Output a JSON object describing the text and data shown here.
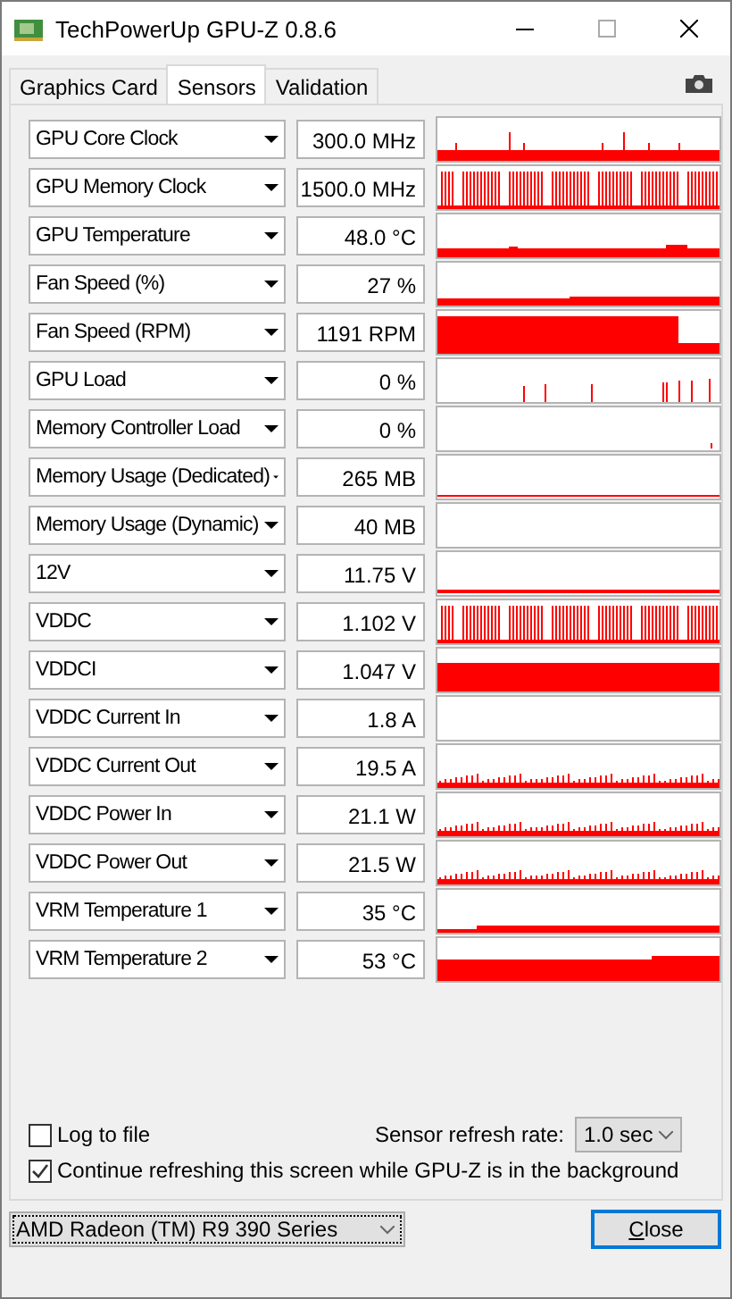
{
  "window": {
    "title": "TechPowerUp GPU-Z 0.8.6"
  },
  "tabs": [
    {
      "label": "Graphics Card",
      "selected": false
    },
    {
      "label": "Sensors",
      "selected": true
    },
    {
      "label": "Validation",
      "selected": false
    }
  ],
  "sensors": [
    {
      "name": "GPU Core Clock",
      "value": "300.0 MHz",
      "kind": "spikes"
    },
    {
      "name": "GPU Memory Clock",
      "value": "1500.0 MHz",
      "kind": "dense"
    },
    {
      "name": "GPU Temperature",
      "value": "48.0 °C",
      "kind": "low"
    },
    {
      "name": "Fan Speed (%)",
      "value": "27 %",
      "kind": "rise"
    },
    {
      "name": "Fan Speed (RPM)",
      "value": "1191 RPM",
      "kind": "drop"
    },
    {
      "name": "GPU Load",
      "value": "0 %",
      "kind": "sparse"
    },
    {
      "name": "Memory Controller Load",
      "value": "0 %",
      "kind": "blip"
    },
    {
      "name": "Memory Usage (Dedicated)",
      "value": "265 MB",
      "kind": "line"
    },
    {
      "name": "Memory Usage (Dynamic)",
      "value": "40 MB",
      "kind": "empty"
    },
    {
      "name": "12V",
      "value": "11.75 V",
      "kind": "flat"
    },
    {
      "name": "VDDC",
      "value": "1.102 V",
      "kind": "dense"
    },
    {
      "name": "VDDCI",
      "value": "1.047 V",
      "kind": "block"
    },
    {
      "name": "VDDC Current In",
      "value": "1.8 A",
      "kind": "empty"
    },
    {
      "name": "VDDC Current Out",
      "value": "19.5 A",
      "kind": "noise"
    },
    {
      "name": "VDDC Power In",
      "value": "21.1 W",
      "kind": "noise"
    },
    {
      "name": "VDDC Power Out",
      "value": "21.5 W",
      "kind": "noise"
    },
    {
      "name": "VRM Temperature 1",
      "value": "35 °C",
      "kind": "step"
    },
    {
      "name": "VRM Temperature 2",
      "value": "53 °C",
      "kind": "mid"
    }
  ],
  "log_to_file": {
    "label": "Log to file",
    "checked": false
  },
  "refresh_rate": {
    "label": "Sensor refresh rate:",
    "value": "1.0 sec"
  },
  "continue_refreshing": {
    "label": "Continue refreshing this screen while GPU-Z is in the background",
    "checked": true
  },
  "gpu_select": {
    "value": "AMD Radeon (TM) R9 390 Series"
  },
  "buttons": [
    "Close"
  ]
}
